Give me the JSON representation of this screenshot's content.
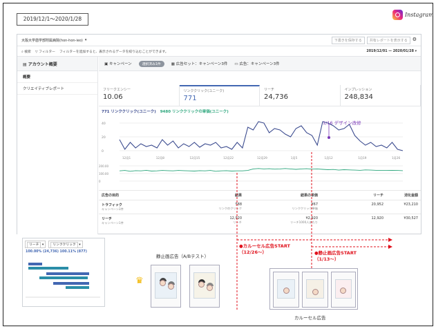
{
  "date_range": "2019/12/1〜2020/1/28",
  "brand": {
    "name": "Instagram",
    "icon": "instagram-logo"
  },
  "toolbar": {
    "account": "大阪大学歯学部附属病院(hon-hon-ieo)",
    "report_button": "下書きを保存する",
    "share_button": "共有レポートを表示する",
    "settings_icon": "gear-icon"
  },
  "filter": {
    "search": "検索",
    "filter_label": "フィルター",
    "hint": "フィルターを追加すると、表示されるデータを絞り込むことができます。",
    "range": "2019/12/01 — 2020/01/28"
  },
  "sidebar": {
    "title": "アカウント概要",
    "items": [
      {
        "label": "概要"
      },
      {
        "label": "クリエイティブレポート"
      }
    ]
  },
  "tabs": [
    {
      "label": "キャンペーン"
    },
    {
      "label": "選択済み1件"
    },
    {
      "label": "広告セット：キャンペーン3件"
    },
    {
      "label": "広告：キャンペーン3件"
    }
  ],
  "metrics": [
    {
      "label": "フリークエンシー",
      "value": "10.06"
    },
    {
      "label": "リンククリック(ユニーク)",
      "value": "771"
    },
    {
      "label": "リーチ",
      "value": "24,736"
    },
    {
      "label": "インプレッション",
      "value": "248,834"
    }
  ],
  "chart_legend": {
    "series_a": "771 リンククリック(ユニーク)",
    "series_b": "9480 リンククリックの単価(ユニーク)"
  },
  "annotation": "1/16 デザイン改修",
  "table": {
    "headers": [
      "広告の目的",
      "結果",
      "結果の単価",
      "リーチ",
      "消化金額"
    ],
    "rows": [
      {
        "c1": "トラフィック",
        "c1sub": "キャンペーン3件",
        "c2": "588",
        "c2sub": "リンクのクリック",
        "c3": "¥67",
        "c3sub": "リンククリック単価",
        "c4": "20,952",
        "c5": "¥23,210"
      },
      {
        "c1": "リーチ",
        "c1sub": "キャンペーン1件",
        "c2": "12,920",
        "c2sub": "リーチ",
        "c3": "¥2,920",
        "c3sub": "リーチ1000人あたり",
        "c4": "12,920",
        "c5": "¥30,527"
      }
    ]
  },
  "breakdown": {
    "select_a": "リーチ",
    "select_b": "リンククリック",
    "kpi": "100.00% (24,736)  100.11% (877)"
  },
  "creatives": {
    "static_label": "静止画広告（A/Bテスト）",
    "carousel_label": "カルーセル広告",
    "carousel_start": "●カルーセル広告START",
    "carousel_start_date": "（12/26〜）",
    "static_start": "●静止画広告START",
    "static_start_date": "（1/13〜）"
  },
  "chart_data": {
    "type": "line",
    "x": [
      "12月1",
      "12月8",
      "12月15",
      "12月22",
      "12月29",
      "1月5",
      "1月12",
      "1月19",
      "1月26"
    ],
    "y_ticks_top": [
      "40",
      "20",
      "0"
    ],
    "y_ticks_bottom": [
      "200.00",
      "100.00",
      "0"
    ],
    "series": [
      {
        "name": "771 リンククリック(ユニーク)",
        "color": "#3b4b8f",
        "values": [
          20,
          6,
          16,
          8,
          14,
          10,
          12,
          8,
          20,
          12,
          18,
          8,
          14,
          10,
          16,
          9,
          14,
          12,
          16,
          8,
          10,
          6,
          16,
          8,
          38,
          34,
          46,
          44,
          30,
          36,
          34,
          28,
          24,
          36,
          40,
          30,
          26,
          12,
          46,
          44,
          40,
          34,
          36,
          42,
          26,
          18,
          12,
          16,
          10,
          12,
          8,
          16,
          6,
          4
        ]
      },
      {
        "name": "9480 リンククリックの単価(ユニーク)",
        "color": "#2aa57b",
        "values": [
          60,
          62,
          58,
          61,
          60,
          63,
          59,
          60,
          62,
          61,
          60,
          62,
          61,
          60,
          59,
          61,
          60,
          62,
          58,
          60,
          61,
          59,
          60,
          60,
          62,
          70,
          72,
          70,
          71,
          69,
          70,
          72,
          70,
          68,
          70,
          71,
          69,
          70,
          68,
          66,
          67,
          64,
          66,
          65,
          64,
          63,
          65,
          64,
          63,
          62,
          62,
          63,
          62,
          61
        ]
      }
    ]
  }
}
